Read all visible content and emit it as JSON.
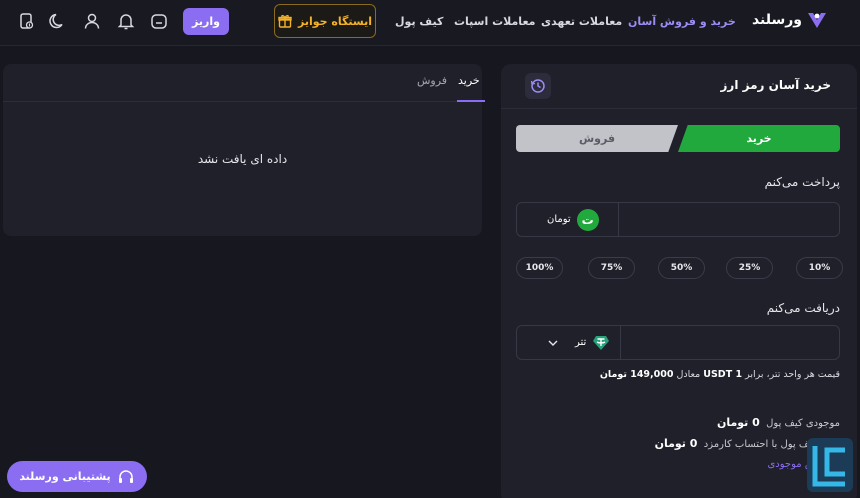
{
  "header": {
    "brand": "ورسلند",
    "nav": {
      "easy_trade": "خرید و فروش آسان",
      "futures": "معاملات تعهدی",
      "spot": "معاملات اسپات",
      "wallet": "کیف پول"
    },
    "rewards": "ایستگاه جوایز",
    "deposit": "واریز"
  },
  "history": {
    "tabs": {
      "buy": "خرید",
      "sell": "فروش"
    },
    "active_tab": "buy",
    "empty_message": "داده ای یافت نشد"
  },
  "trade": {
    "title": "خرید آسان رمز ارز",
    "buy_label": "خرید",
    "sell_label": "فروش",
    "pay_label": "پرداخت می‌کنم",
    "pay_currency": "تومان",
    "pay_currency_symbol": "ت",
    "percentages": [
      "10%",
      "25%",
      "50%",
      "75%",
      "100%"
    ],
    "receive_label": "دریافت می‌کنم",
    "receive_currency": "تتر",
    "price_note_prefix": "قیمت هر واحد تتر، برابر",
    "price_note_unit": "USDT 1",
    "price_note_mid": "معادل",
    "price_note_value": "149,000 تومان",
    "balance_label": "موجودی کیف پول",
    "balance_value": "0 تومان",
    "balance_fee_label": "کیف پول با احتساب کارمزد",
    "balance_fee_value": "0 تومان",
    "link_text": "ش موجودی"
  },
  "support": {
    "label": "پشتیبانی ورسلند"
  },
  "colors": {
    "accent": "#8a6df0",
    "buy": "#22a93e",
    "gold": "#f4b22a"
  }
}
